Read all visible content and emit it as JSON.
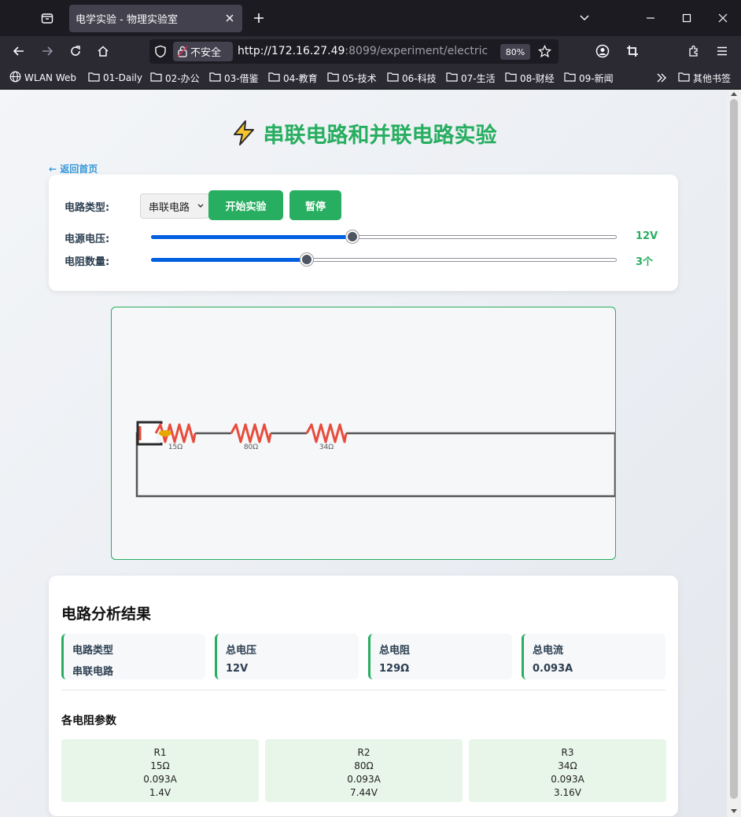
{
  "browser": {
    "tab_title": "电学实验 - 物理实验室",
    "insecure_label": "不安全",
    "url_main": "http://172.16.27.49",
    "url_rest": ":8099/experiment/electric",
    "zoom": "80%",
    "bookmarks": [
      "WLAN Web",
      "01-Daily",
      "02-办公",
      "03-借鉴",
      "04-教育",
      "05-技术",
      "06-科技",
      "07-生活",
      "08-财经",
      "09-新闻"
    ],
    "other_bookmarks": "其他书签"
  },
  "page": {
    "title": "串联电路和并联电路实验",
    "back_link": "← 返回首页"
  },
  "controls": {
    "circuit_type_label": "电路类型:",
    "circuit_type_value": "串联电路",
    "start_button": "开始实验",
    "pause_button": "暂停",
    "voltage_label": "电源电压:",
    "voltage_value": "12V",
    "voltage_fraction": 0.43,
    "resistor_count_label": "电阻数量:",
    "resistor_count_value": "3个",
    "resistor_count_fraction": 0.33
  },
  "circuit": {
    "resistors": [
      "15Ω",
      "80Ω",
      "34Ω"
    ]
  },
  "results": {
    "title": "电路分析结果",
    "stats": [
      {
        "label": "电路类型",
        "value": "串联电路"
      },
      {
        "label": "总电压",
        "value": "12V"
      },
      {
        "label": "总电阻",
        "value": "129Ω"
      },
      {
        "label": "总电流",
        "value": "0.093A"
      }
    ],
    "params_title": "各电阻参数",
    "resistor_params": [
      {
        "name": "R1",
        "resistance": "15Ω",
        "current": "0.093A",
        "voltage": "1.4V"
      },
      {
        "name": "R2",
        "resistance": "80Ω",
        "current": "0.093A",
        "voltage": "7.44V"
      },
      {
        "name": "R3",
        "resistance": "34Ω",
        "current": "0.093A",
        "voltage": "3.16V"
      }
    ]
  },
  "colors": {
    "accent": "#27ae60",
    "link": "#3498db",
    "resistor": "#e74c3c",
    "wire": "#555555"
  }
}
